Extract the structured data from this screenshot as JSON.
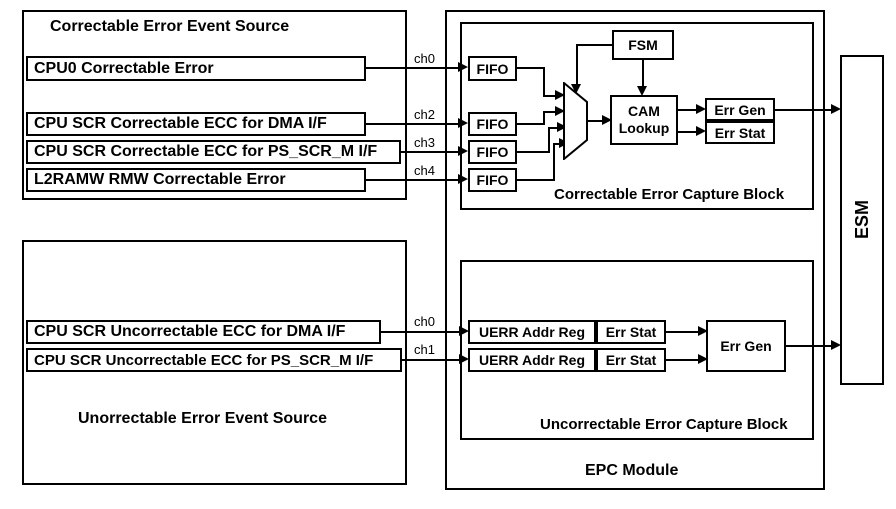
{
  "correctable_source": {
    "title": "Correctable Error Event Source",
    "items": [
      {
        "label": "CPU0 Correctable Error",
        "ch": "ch0"
      },
      {
        "label": "CPU SCR Correctable ECC for DMA I/F",
        "ch": "ch2"
      },
      {
        "label": "CPU  SCR Correctable ECC for PS_SCR_M I/F",
        "ch": "ch3"
      },
      {
        "label": "L2RAMW RMW Correctable Error",
        "ch": "ch4"
      }
    ]
  },
  "uncorrectable_source": {
    "title": "Unorrectable Error Event Source",
    "items": [
      {
        "label": "CPU SCR Uncorrectable ECC for DMA I/F",
        "ch": "ch0"
      },
      {
        "label": "CPU SCR Uncorrectable ECC for PS_SCR_M I/F",
        "ch": "ch1"
      }
    ]
  },
  "epc": {
    "title": "EPC Module",
    "correctable_block": {
      "title": "Correctable Error Capture Block",
      "fifo_label": "FIFO",
      "fsm_label": "FSM",
      "cam_label": "CAM\nLookup",
      "err_gen_label": "Err Gen",
      "err_stat_label": "Err Stat"
    },
    "uncorrectable_block": {
      "title": "Uncorrectable Error Capture Block",
      "uerr_label": "UERR Addr Reg",
      "err_stat_label": "Err Stat",
      "err_gen_label": "Err Gen"
    }
  },
  "esm_label": "ESM"
}
